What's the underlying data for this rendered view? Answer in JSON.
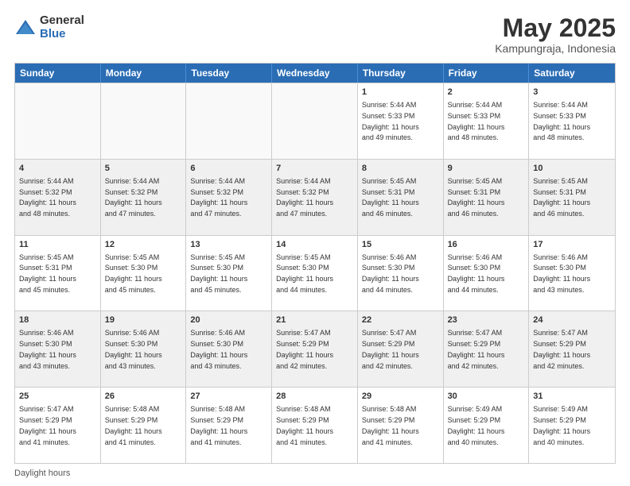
{
  "logo": {
    "general": "General",
    "blue": "Blue"
  },
  "title": {
    "month": "May 2025",
    "location": "Kampungraja, Indonesia"
  },
  "header": {
    "days": [
      "Sunday",
      "Monday",
      "Tuesday",
      "Wednesday",
      "Thursday",
      "Friday",
      "Saturday"
    ]
  },
  "footer": {
    "text": "Daylight hours"
  },
  "weeks": [
    [
      {
        "day": "",
        "empty": true
      },
      {
        "day": "",
        "empty": true
      },
      {
        "day": "",
        "empty": true
      },
      {
        "day": "",
        "empty": true
      },
      {
        "day": "1",
        "lines": [
          "Sunrise: 5:44 AM",
          "Sunset: 5:33 PM",
          "Daylight: 11 hours",
          "and 49 minutes."
        ]
      },
      {
        "day": "2",
        "lines": [
          "Sunrise: 5:44 AM",
          "Sunset: 5:33 PM",
          "Daylight: 11 hours",
          "and 48 minutes."
        ]
      },
      {
        "day": "3",
        "lines": [
          "Sunrise: 5:44 AM",
          "Sunset: 5:33 PM",
          "Daylight: 11 hours",
          "and 48 minutes."
        ]
      }
    ],
    [
      {
        "day": "4",
        "lines": [
          "Sunrise: 5:44 AM",
          "Sunset: 5:32 PM",
          "Daylight: 11 hours",
          "and 48 minutes."
        ]
      },
      {
        "day": "5",
        "lines": [
          "Sunrise: 5:44 AM",
          "Sunset: 5:32 PM",
          "Daylight: 11 hours",
          "and 47 minutes."
        ]
      },
      {
        "day": "6",
        "lines": [
          "Sunrise: 5:44 AM",
          "Sunset: 5:32 PM",
          "Daylight: 11 hours",
          "and 47 minutes."
        ]
      },
      {
        "day": "7",
        "lines": [
          "Sunrise: 5:44 AM",
          "Sunset: 5:32 PM",
          "Daylight: 11 hours",
          "and 47 minutes."
        ]
      },
      {
        "day": "8",
        "lines": [
          "Sunrise: 5:45 AM",
          "Sunset: 5:31 PM",
          "Daylight: 11 hours",
          "and 46 minutes."
        ]
      },
      {
        "day": "9",
        "lines": [
          "Sunrise: 5:45 AM",
          "Sunset: 5:31 PM",
          "Daylight: 11 hours",
          "and 46 minutes."
        ]
      },
      {
        "day": "10",
        "lines": [
          "Sunrise: 5:45 AM",
          "Sunset: 5:31 PM",
          "Daylight: 11 hours",
          "and 46 minutes."
        ]
      }
    ],
    [
      {
        "day": "11",
        "lines": [
          "Sunrise: 5:45 AM",
          "Sunset: 5:31 PM",
          "Daylight: 11 hours",
          "and 45 minutes."
        ]
      },
      {
        "day": "12",
        "lines": [
          "Sunrise: 5:45 AM",
          "Sunset: 5:30 PM",
          "Daylight: 11 hours",
          "and 45 minutes."
        ]
      },
      {
        "day": "13",
        "lines": [
          "Sunrise: 5:45 AM",
          "Sunset: 5:30 PM",
          "Daylight: 11 hours",
          "and 45 minutes."
        ]
      },
      {
        "day": "14",
        "lines": [
          "Sunrise: 5:45 AM",
          "Sunset: 5:30 PM",
          "Daylight: 11 hours",
          "and 44 minutes."
        ]
      },
      {
        "day": "15",
        "lines": [
          "Sunrise: 5:46 AM",
          "Sunset: 5:30 PM",
          "Daylight: 11 hours",
          "and 44 minutes."
        ]
      },
      {
        "day": "16",
        "lines": [
          "Sunrise: 5:46 AM",
          "Sunset: 5:30 PM",
          "Daylight: 11 hours",
          "and 44 minutes."
        ]
      },
      {
        "day": "17",
        "lines": [
          "Sunrise: 5:46 AM",
          "Sunset: 5:30 PM",
          "Daylight: 11 hours",
          "and 43 minutes."
        ]
      }
    ],
    [
      {
        "day": "18",
        "lines": [
          "Sunrise: 5:46 AM",
          "Sunset: 5:30 PM",
          "Daylight: 11 hours",
          "and 43 minutes."
        ]
      },
      {
        "day": "19",
        "lines": [
          "Sunrise: 5:46 AM",
          "Sunset: 5:30 PM",
          "Daylight: 11 hours",
          "and 43 minutes."
        ]
      },
      {
        "day": "20",
        "lines": [
          "Sunrise: 5:46 AM",
          "Sunset: 5:30 PM",
          "Daylight: 11 hours",
          "and 43 minutes."
        ]
      },
      {
        "day": "21",
        "lines": [
          "Sunrise: 5:47 AM",
          "Sunset: 5:29 PM",
          "Daylight: 11 hours",
          "and 42 minutes."
        ]
      },
      {
        "day": "22",
        "lines": [
          "Sunrise: 5:47 AM",
          "Sunset: 5:29 PM",
          "Daylight: 11 hours",
          "and 42 minutes."
        ]
      },
      {
        "day": "23",
        "lines": [
          "Sunrise: 5:47 AM",
          "Sunset: 5:29 PM",
          "Daylight: 11 hours",
          "and 42 minutes."
        ]
      },
      {
        "day": "24",
        "lines": [
          "Sunrise: 5:47 AM",
          "Sunset: 5:29 PM",
          "Daylight: 11 hours",
          "and 42 minutes."
        ]
      }
    ],
    [
      {
        "day": "25",
        "lines": [
          "Sunrise: 5:47 AM",
          "Sunset: 5:29 PM",
          "Daylight: 11 hours",
          "and 41 minutes."
        ]
      },
      {
        "day": "26",
        "lines": [
          "Sunrise: 5:48 AM",
          "Sunset: 5:29 PM",
          "Daylight: 11 hours",
          "and 41 minutes."
        ]
      },
      {
        "day": "27",
        "lines": [
          "Sunrise: 5:48 AM",
          "Sunset: 5:29 PM",
          "Daylight: 11 hours",
          "and 41 minutes."
        ]
      },
      {
        "day": "28",
        "lines": [
          "Sunrise: 5:48 AM",
          "Sunset: 5:29 PM",
          "Daylight: 11 hours",
          "and 41 minutes."
        ]
      },
      {
        "day": "29",
        "lines": [
          "Sunrise: 5:48 AM",
          "Sunset: 5:29 PM",
          "Daylight: 11 hours",
          "and 41 minutes."
        ]
      },
      {
        "day": "30",
        "lines": [
          "Sunrise: 5:49 AM",
          "Sunset: 5:29 PM",
          "Daylight: 11 hours",
          "and 40 minutes."
        ]
      },
      {
        "day": "31",
        "lines": [
          "Sunrise: 5:49 AM",
          "Sunset: 5:29 PM",
          "Daylight: 11 hours",
          "and 40 minutes."
        ]
      }
    ]
  ]
}
